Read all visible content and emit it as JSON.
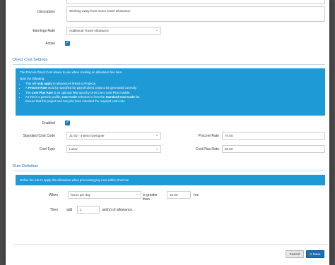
{
  "form": {
    "description_label": "Description",
    "description_value": "Working away from home travel allowance.",
    "earnings_rate_label": "Earnings Rate",
    "earnings_rate_value": "Additional Travel Allowance",
    "active_label": "Active"
  },
  "direct_cost": {
    "section_title": "Direct Cost Settings",
    "info_intro": "The Procore Direct Cost values to use when creating an allowance line item.",
    "info_note": "Note the following:",
    "bullets": [
      {
        "pre": "This will ",
        "bold": "only apply",
        "post": " to allowances linked to Projects."
      },
      {
        "pre": "A ",
        "bold": "Procore Rate",
        "post": " must be specified for payroll direct costs to be generated correctly."
      },
      {
        "pre": "The ",
        "bold": "Cost Plus Rate",
        "post": " is an optional field used by OneCore's Cost Plus module."
      },
      {
        "pre": "As this is a generic profile, ",
        "bold": "Cost Code",
        "post": " selection is from the "
      },
      {
        "pre": "Ensure that the project and sub jobs have inherited the required cost code.",
        "bold": "",
        "post": ""
      }
    ],
    "bullet4_bold2": "Standard Cost Code",
    "bullet4_end": " list.",
    "enabled_label": "Enabled",
    "standard_cost_code_label": "Standard Cost Code",
    "standard_cost_code_value": "31-02 - Interior Designer",
    "cost_type_label": "Cost Type",
    "cost_type_value": "Labor",
    "procore_rate_label": "Procore Rate",
    "procore_rate_value": "70.00",
    "cost_plus_rate_label": "Cost Plus Rate",
    "cost_plus_rate_value": "90.00"
  },
  "rule": {
    "section_title": "Rule Definition",
    "info_text": "Define the rule to apply this allowance when processing pay runs within OneCore.",
    "when_label": "When",
    "when_value": "hours per day",
    "greater_than_text": "is greater than",
    "threshold_value": "10.00",
    "hrs_text": "hrs",
    "then_label": "Then",
    "add_text": "add",
    "add_value": "1",
    "units_text": "unit(s) of allowance."
  },
  "footer": {
    "cancel_label": "Cancel",
    "save_label": "Save"
  },
  "colors": {
    "accent": "#2273b9",
    "info_bg": "#1e9ad6",
    "save_bg": "#1d6fb8"
  }
}
